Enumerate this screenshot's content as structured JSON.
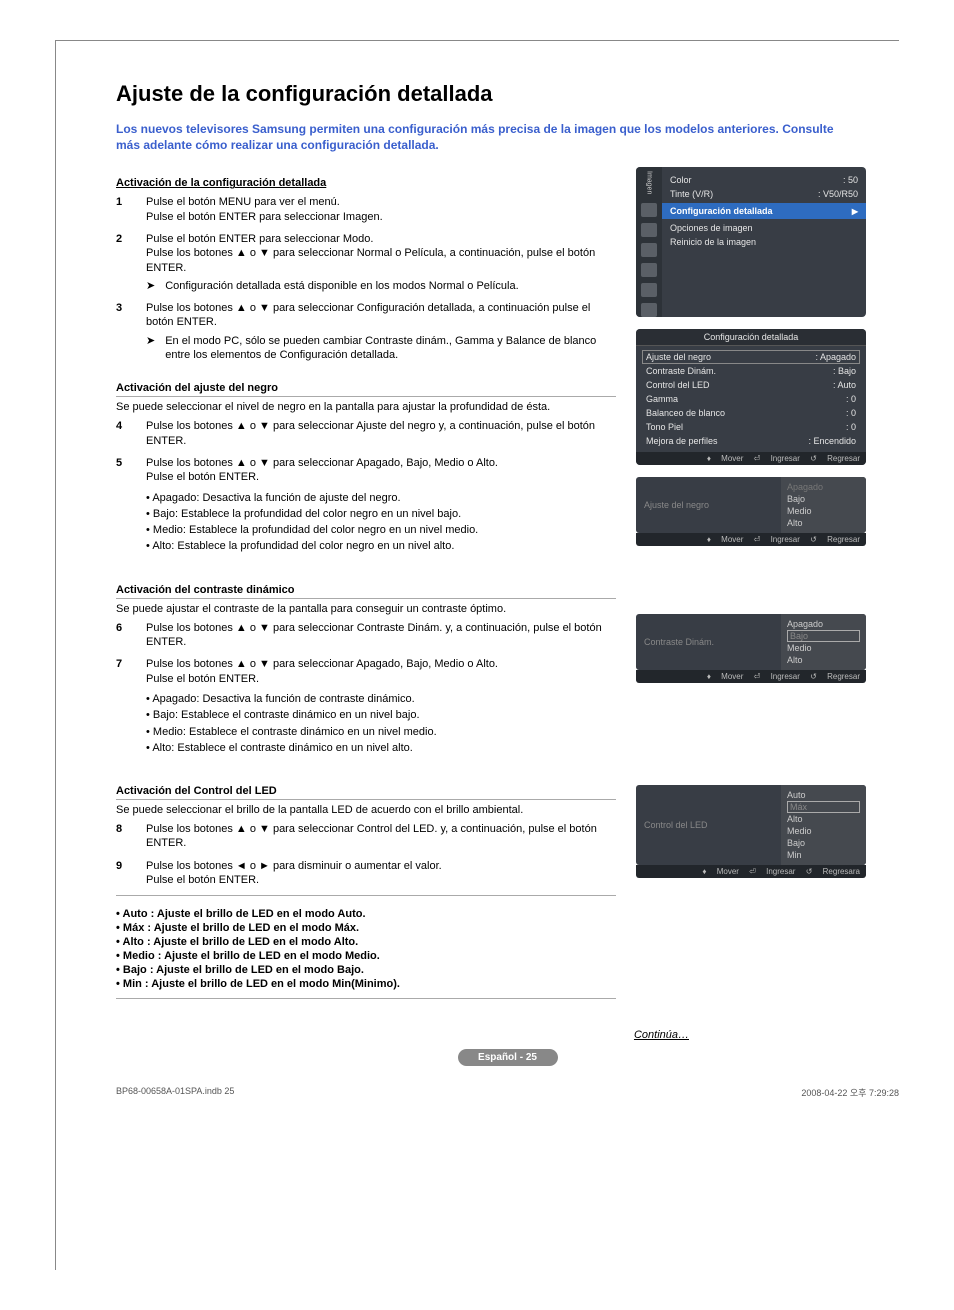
{
  "heading": "Ajuste de la configuración detallada",
  "intro": "Los nuevos televisores Samsung permiten una configuración más precisa de la imagen que los modelos anteriores. Consulte más adelante cómo realizar una configuración detallada.",
  "section1_title": "Activación de la configuración detallada",
  "step1": {
    "num": "1",
    "l1": "Pulse el botón MENU para ver el menú.",
    "l2": "Pulse el botón ENTER para seleccionar Imagen."
  },
  "step2": {
    "num": "2",
    "l1": "Pulse el botón  ENTER para seleccionar Modo.",
    "l2": "Pulse los botones ▲ o ▼ para seleccionar Normal o Película, a continuación, pulse el botón ENTER.",
    "note": "Configuración detallada está disponible en los modos Normal o Película."
  },
  "step3": {
    "num": "3",
    "l1": "Pulse los botones ▲ o ▼ para seleccionar Configuración detallada, a continuación pulse el botón ENTER.",
    "note": "En el modo PC, sólo se pueden cambiar Contraste dinám., Gamma y Balance de blanco entre los elementos de Configuración detallada."
  },
  "section2_title": "Activación del ajuste del negro",
  "section2_desc": "Se puede seleccionar el nivel de negro en la pantalla para ajustar la profundidad de ésta.",
  "step4": {
    "num": "4",
    "text": "Pulse los botones ▲ o ▼ para seleccionar Ajuste del negro y, a continuación, pulse el botón ENTER."
  },
  "step5": {
    "num": "5",
    "l1": "Pulse los botones ▲ o ▼ para seleccionar Apagado, Bajo, Medio o Alto.",
    "l2": "Pulse el botón ENTER.",
    "b1": "Apagado: Desactiva la función de ajuste del negro.",
    "b2": "Bajo: Establece la profundidad del color negro en un nivel bajo.",
    "b3": "Medio: Establece la profundidad del color negro en un nivel medio.",
    "b4": "Alto: Establece la profundidad del color negro en un nivel alto."
  },
  "section3_title": "Activación del contraste dinámico",
  "section3_desc": "Se puede ajustar el contraste de la pantalla para conseguir un contraste óptimo.",
  "step6": {
    "num": "6",
    "text": "Pulse los botones ▲ o ▼ para seleccionar Contraste Dinám. y, a continuación, pulse el botón ENTER."
  },
  "step7": {
    "num": "7",
    "l1": "Pulse los botones ▲ o ▼ para seleccionar Apagado, Bajo, Medio o Alto.",
    "l2": "Pulse el botón ENTER.",
    "b1": "Apagado: Desactiva la función de contraste dinámico.",
    "b2": "Bajo: Establece el contraste dinámico en un nivel bajo.",
    "b3": "Medio: Establece el contraste dinámico en un nivel medio.",
    "b4": "Alto: Establece el contraste dinámico en un nivel alto."
  },
  "section4_title": "Activación del Control del LED",
  "section4_desc": "Se puede seleccionar el brillo de la pantalla LED de acuerdo con el brillo ambiental.",
  "step8": {
    "num": "8",
    "text": "Pulse los botones ▲ o ▼ para seleccionar Control del LED. y, a continuación, pulse el botón ENTER."
  },
  "step9": {
    "num": "9",
    "l1": "Pulse los botones ◄ o ► para disminuir o aumentar el valor.",
    "l2": "Pulse el botón ENTER."
  },
  "s4b1": "Auto : Ajuste el brillo de LED en el modo Auto.",
  "s4b2": "Máx : Ajuste el brillo de LED en el modo Máx.",
  "s4b3": "Alto : Ajuste el brillo de LED en el modo Alto.",
  "s4b4": "Medio : Ajuste el brillo de LED en el modo Medio.",
  "s4b5": "Bajo : Ajuste el brillo de LED en el modo Bajo.",
  "s4b6": "Min : Ajuste el brillo de LED en el modo Min(Minimo).",
  "osd1": {
    "side_label": "Imagen",
    "color_l": "Color",
    "color_v": ": 50",
    "tint_l": "Tinte (V/R)",
    "tint_v": ": V50/R50",
    "sel": "Configuración detallada",
    "opt1": "Opciones de imagen",
    "opt2": "Reinicio de la imagen"
  },
  "osd2": {
    "title": "Configuración detallada",
    "r1l": "Ajuste del negro",
    "r1v": ": Apagado",
    "r2l": "Contraste Dinám.",
    "r2v": ": Bajo",
    "r3l": "Control del LED",
    "r3v": ": Auto",
    "r4l": "Gamma",
    "r4v": ": 0",
    "r5l": "Balanceo de blanco",
    "r5v": ": 0",
    "r6l": "Tono Piel",
    "r6v": ": 0",
    "r7l": "Mejora de perfiles",
    "r7v": ": Encendido"
  },
  "popup1": {
    "label": "Ajuste del negro",
    "o1": "Apagado",
    "o2": "Bajo",
    "o3": "Medio",
    "o4": "Alto"
  },
  "popup2": {
    "label": "Contraste Dinám.",
    "o1": "Apagado",
    "o2": "Bajo",
    "o3": "Medio",
    "o4": "Alto"
  },
  "popup3": {
    "label": "Control del LED",
    "o1": "Auto",
    "o2": "Máx",
    "o3": "Alto",
    "o4": "Medio",
    "o5": "Bajo",
    "o6": "Min"
  },
  "foot": {
    "move": "Mover",
    "enter": "Ingresar",
    "back": "Regresar",
    "back2": "Regresara"
  },
  "continue": "Continúa…",
  "page_badge": "Español - 25",
  "footer_left": "BP68-00658A-01SPA.indb   25",
  "footer_right": "2008-04-22   오후 7:29:28"
}
